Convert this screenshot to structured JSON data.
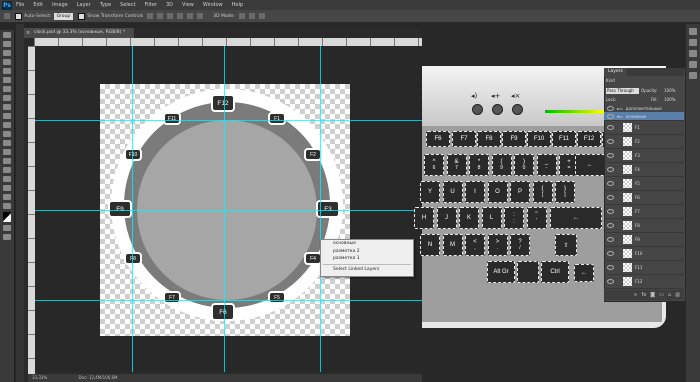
{
  "app": {
    "logo": "Ps",
    "brand_color": "#3fa9f5"
  },
  "menu": [
    "File",
    "Edit",
    "Image",
    "Layer",
    "Type",
    "Select",
    "Filter",
    "3D",
    "View",
    "Window",
    "Help"
  ],
  "options_bar": {
    "auto_select_label": "Auto-Select:",
    "auto_select_value": "Group",
    "transform_controls_label": "Show Transform Controls",
    "mode_3d_label": "3D Mode:"
  },
  "document": {
    "tab_title": "clock.psd @ 33,3% (основные, RGB/8) *",
    "zoom": "33,33%",
    "doc_size": "Doc: 12,4M/106,6M"
  },
  "fkeys_large": [
    "F12",
    "F3",
    "F6",
    "F9"
  ],
  "fkeys_small": [
    "F1",
    "F2",
    "F4",
    "F5",
    "F7",
    "F8",
    "F10",
    "F11"
  ],
  "context_menu": {
    "items": [
      "основные",
      "разметка 2",
      "разметка 1"
    ],
    "action": "Select Linked Layers"
  },
  "keyboard": {
    "row1": [
      "F6",
      "F7",
      "F8",
      "F9",
      "F10",
      "F11",
      "F12",
      "Prt Sc",
      "Delete"
    ],
    "row2": [
      "^",
      "&",
      "*",
      "(",
      ")",
      "_",
      "+"
    ],
    "row2_sub": [
      "6",
      "7",
      "8",
      "9",
      "0",
      "-",
      "="
    ],
    "row3": [
      "Y",
      "U",
      "I",
      "O",
      "P",
      "{",
      "}"
    ],
    "row3_sub": [
      "",
      "",
      "",
      "",
      "",
      "[",
      "]"
    ],
    "row4": [
      "H",
      "J",
      "K",
      "L",
      ":",
      "\""
    ],
    "row4_sub": [
      "",
      "",
      "",
      "",
      ";",
      "'"
    ],
    "row5": [
      "N",
      "M",
      "<",
      ">",
      "?"
    ],
    "row5_sub": [
      "",
      "",
      ",",
      ".",
      "/"
    ],
    "row6": [
      "Alt Gr",
      "Ctrl"
    ],
    "arrow_left": "←",
    "arrow_up": "⇧"
  },
  "layers_panel": {
    "tab": "Layers",
    "kind_label": "Kind",
    "blend_mode": "Pass Through",
    "opacity_label": "Opacity:",
    "opacity_value": "100%",
    "lock_label": "Lock:",
    "fill_label": "Fill:",
    "fill_value": "100%",
    "groups": [
      "дополнительные",
      "основные"
    ],
    "layers": [
      "F1",
      "F2",
      "F3",
      "F4",
      "F5",
      "F6",
      "F7",
      "F8",
      "F9",
      "F10",
      "F11",
      "F12"
    ]
  }
}
